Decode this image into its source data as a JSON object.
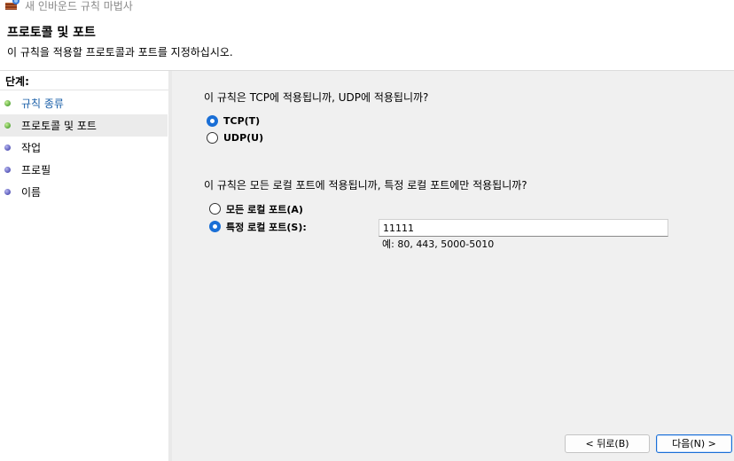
{
  "window": {
    "title": "새 인바운드 규칙 마법사"
  },
  "header": {
    "title": "프로토콜 및 포트",
    "subtitle": "이 규칙을 적용할 프로토콜과 포트를 지정하십시오."
  },
  "sidebar": {
    "heading": "단계:",
    "items": [
      {
        "label": "규칙 종류",
        "state": "completed",
        "dot_color": "#58a83a"
      },
      {
        "label": "프로토콜 및 포트",
        "state": "current",
        "dot_color": "#58a83a"
      },
      {
        "label": "작업",
        "state": "pending",
        "dot_color": "#5656b8"
      },
      {
        "label": "프로필",
        "state": "pending",
        "dot_color": "#5656b8"
      },
      {
        "label": "이름",
        "state": "pending",
        "dot_color": "#5656b8"
      }
    ]
  },
  "main": {
    "protocol_question": "이 규칙은 TCP에 적용됩니까, UDP에 적용됩니까?",
    "protocol_options": [
      {
        "label": "TCP(T)",
        "selected": true
      },
      {
        "label": "UDP(U)",
        "selected": false
      }
    ],
    "port_question": "이 규칙은 모든 로컬 포트에 적용됩니까, 특정 로컬 포트에만 적용됩니까?",
    "port_options": [
      {
        "label": "모든 로컬 포트(A)",
        "selected": false
      },
      {
        "label": "특정 로컬 포트(S):",
        "selected": true
      }
    ],
    "port_value": "11111",
    "port_example": "예: 80, 443, 5000-5010"
  },
  "buttons": {
    "back": "< 뒤로(B)",
    "next": "다음(N) >"
  },
  "colors": {
    "accent": "#1a6fd6",
    "link": "#1a5fa8",
    "content_bg": "#f0f0f0",
    "active_step_bg": "#ebebeb"
  }
}
